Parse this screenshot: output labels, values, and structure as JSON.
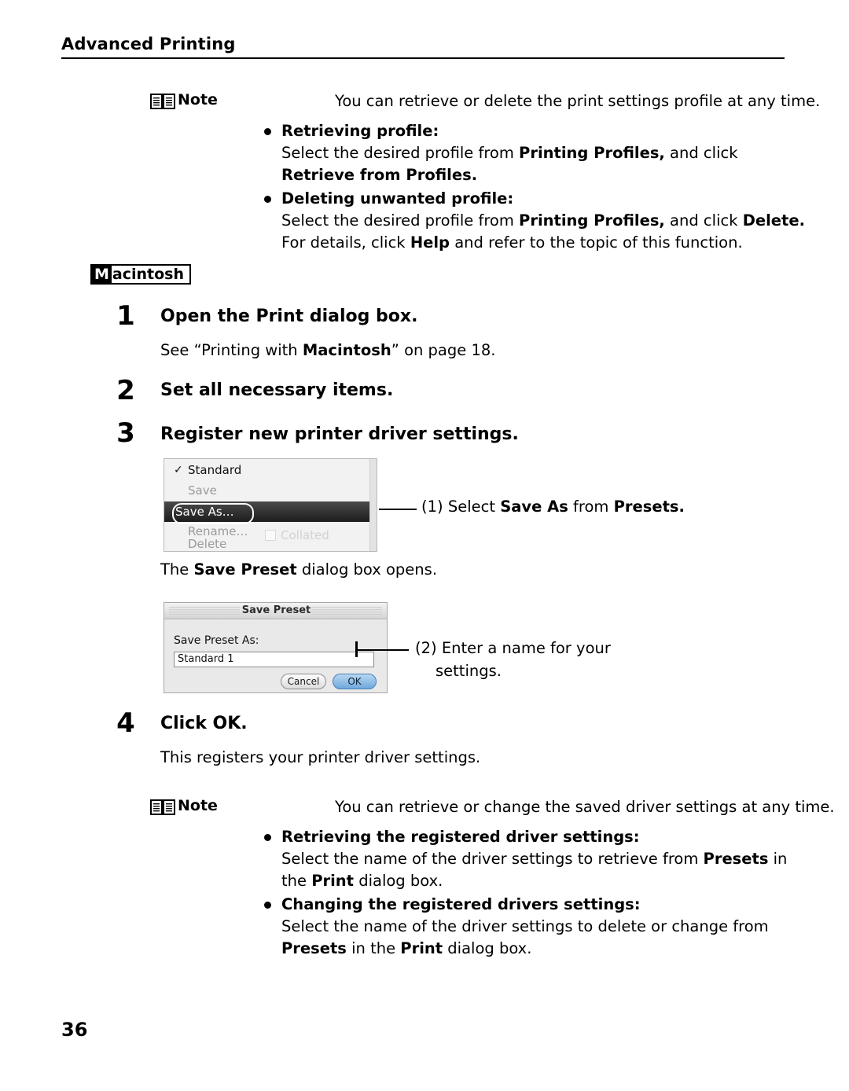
{
  "header": {
    "title": "Advanced Printing"
  },
  "note1": {
    "icon": "book-icon",
    "label": "Note",
    "intro": "You can retrieve or delete the print settings profile at any time.",
    "items": [
      {
        "title": "Retrieving profile:",
        "lines": [
          [
            {
              "t": "Select the desired profile from ",
              "b": false
            },
            {
              "t": "Printing Profiles,",
              "b": true
            },
            {
              "t": " and click",
              "b": false
            }
          ],
          [
            {
              "t": "Retrieve from Profiles.",
              "b": true
            }
          ]
        ]
      },
      {
        "title": "Deleting unwanted profile:",
        "lines": [
          [
            {
              "t": "Select the desired profile from ",
              "b": false
            },
            {
              "t": "Printing Profiles,",
              "b": true
            },
            {
              "t": " and click ",
              "b": false
            },
            {
              "t": "Delete.",
              "b": true
            }
          ],
          [
            {
              "t": "For details, click ",
              "b": false
            },
            {
              "t": "Help",
              "b": true
            },
            {
              "t": " and refer to the topic of this function.",
              "b": false
            }
          ]
        ]
      }
    ]
  },
  "platform_tag": {
    "first_letter": "M",
    "rest": "acintosh"
  },
  "steps": [
    {
      "number": "1",
      "title_parts": [
        {
          "t": "Open the ",
          "b": true
        },
        {
          "t": "Print",
          "b": true
        },
        {
          "t": " dialog box.",
          "b": true
        }
      ],
      "body_parts": [
        {
          "t": "See “Printing with ",
          "b": false
        },
        {
          "t": "Macintosh",
          "b": true
        },
        {
          "t": "” on page 18.",
          "b": false
        }
      ]
    },
    {
      "number": "2",
      "title": "Set all necessary items."
    },
    {
      "number": "3",
      "title": "Register new printer driver settings."
    },
    {
      "number": "4",
      "title": "Click OK.",
      "body": "This registers your printer driver settings."
    }
  ],
  "presets_menu": {
    "items": [
      {
        "label": "Standard",
        "checked": true,
        "dim": false
      },
      {
        "label": "Save",
        "checked": false,
        "dim": true
      },
      {
        "label": "Save As…",
        "checked": false,
        "dim": false,
        "highlighted": true
      },
      {
        "label": "Rename…",
        "checked": false,
        "dim": true
      },
      {
        "label": "Delete",
        "checked": false,
        "dim": true
      }
    ],
    "ghost_label": "Collated"
  },
  "callout1": {
    "number": "(1)",
    "parts": [
      {
        "t": "Select ",
        "b": false
      },
      {
        "t": "Save As",
        "b": true
      },
      {
        "t": " from ",
        "b": false
      },
      {
        "t": "Presets.",
        "b": true
      }
    ]
  },
  "after_menu_text": [
    {
      "t": "The ",
      "b": false
    },
    {
      "t": "Save Preset",
      "b": true
    },
    {
      "t": " dialog box opens.",
      "b": false
    }
  ],
  "save_preset_dialog": {
    "title": "Save Preset",
    "field_label": "Save Preset As:",
    "field_value": "Standard 1",
    "cancel_label": "Cancel",
    "ok_label": "OK"
  },
  "callout2": {
    "number": "(2)",
    "line1": "Enter a name for your",
    "line2": "settings."
  },
  "note2": {
    "icon": "book-icon",
    "label": "Note",
    "intro": "You can retrieve or change the saved driver settings at any time.",
    "items": [
      {
        "title": "Retrieving the registered driver settings:",
        "lines": [
          [
            {
              "t": "Select the name of the driver settings to retrieve from ",
              "b": false
            },
            {
              "t": "Presets",
              "b": true
            },
            {
              "t": " in",
              "b": false
            }
          ],
          [
            {
              "t": "the ",
              "b": false
            },
            {
              "t": "Print",
              "b": true
            },
            {
              "t": " dialog box.",
              "b": false
            }
          ]
        ]
      },
      {
        "title": "Changing the registered drivers settings:",
        "lines": [
          [
            {
              "t": "Select the name of the driver settings to delete or change from",
              "b": false
            }
          ],
          [
            {
              "t": "Presets",
              "b": true
            },
            {
              "t": " in the ",
              "b": false
            },
            {
              "t": "Print",
              "b": true
            },
            {
              "t": " dialog box.",
              "b": false
            }
          ]
        ]
      }
    ]
  },
  "page_number": "36"
}
